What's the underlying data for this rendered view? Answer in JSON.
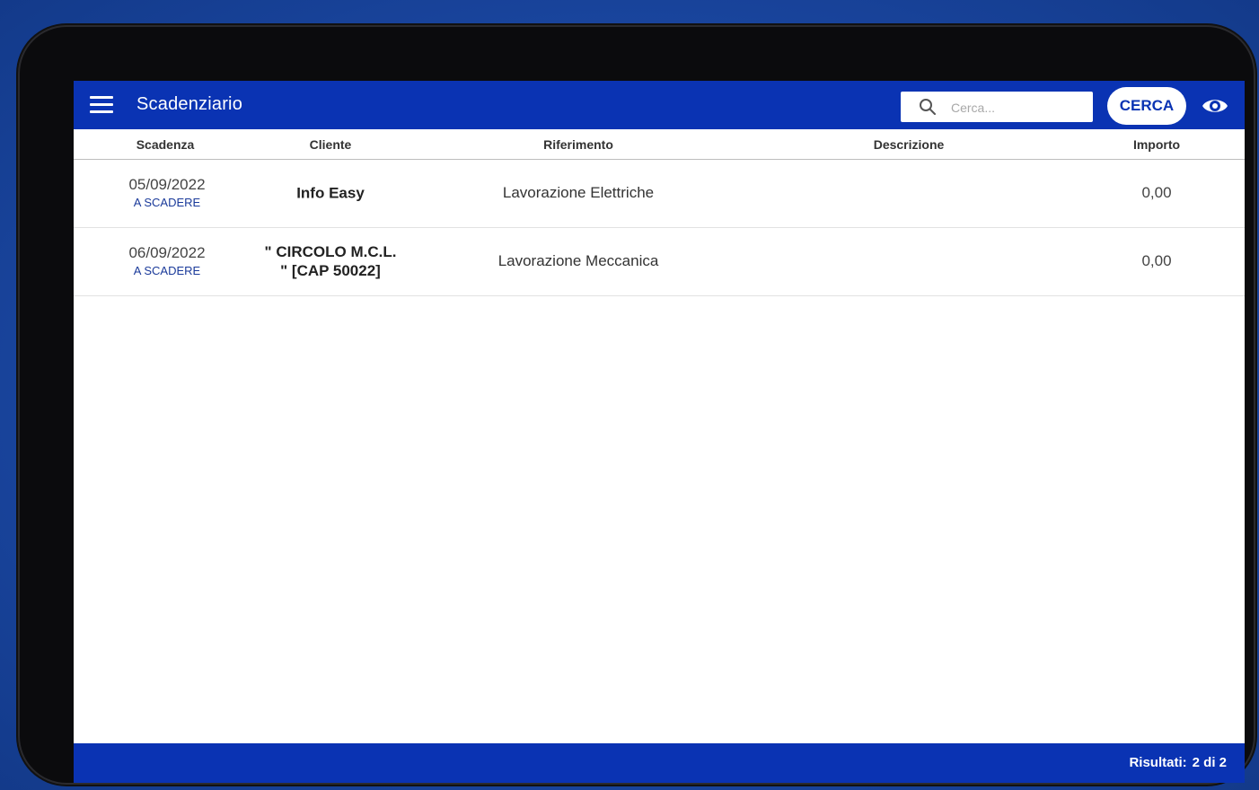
{
  "header": {
    "title": "Scadenziario",
    "search_placeholder": "Cerca...",
    "search_button": "CERCA"
  },
  "table": {
    "columns": [
      "Scadenza",
      "Cliente",
      "Riferimento",
      "Descrizione",
      "Importo"
    ],
    "rows": [
      {
        "date": "05/09/2022",
        "status": "A SCADERE",
        "client_line1": "Info Easy",
        "client_line2": "",
        "reference": "Lavorazione Elettriche",
        "description": "",
        "amount": "0,00"
      },
      {
        "date": "06/09/2022",
        "status": "A SCADERE",
        "client_line1": "\" CIRCOLO M.C.L.",
        "client_line2": "\" [CAP 50022]",
        "reference": "Lavorazione Meccanica",
        "description": "",
        "amount": "0,00"
      }
    ]
  },
  "footer": {
    "results_label": "Risultati:",
    "results_value": "2 di 2"
  },
  "colors": {
    "primary": "#0a33b3",
    "status": "#1a3a9a"
  },
  "icons": [
    "menu-icon",
    "search-icon",
    "eye-icon"
  ]
}
